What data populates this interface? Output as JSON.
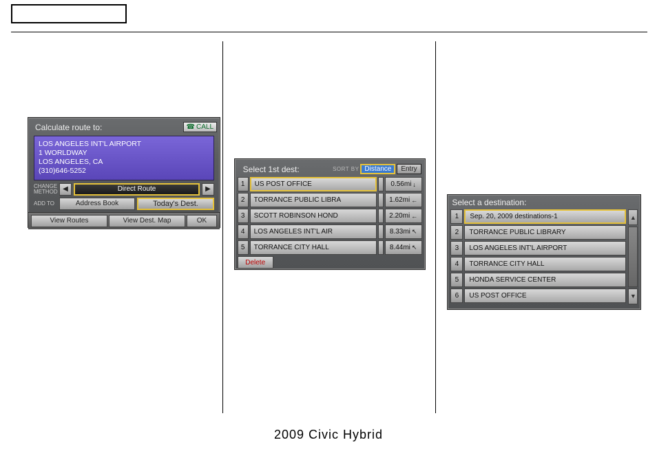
{
  "footer": "2009  Civic  Hybrid",
  "panel1": {
    "title": "Calculate route to:",
    "call": "CALL",
    "address": {
      "line1": "LOS ANGELES INT'L AIRPORT",
      "line2": "1 WORLDWAY",
      "line3": "LOS ANGELES, CA",
      "line4": "(310)646-5252"
    },
    "change_method_label": "CHANGE METHOD",
    "direct_route": "Direct Route",
    "add_to_label": "ADD TO",
    "address_book": "Address Book",
    "todays_dest": "Today's Dest.",
    "view_routes": "View Routes",
    "view_dest_map": "View Dest. Map",
    "ok": "OK"
  },
  "panel2": {
    "title": "Select 1st dest:",
    "sort_label": "SORT BY",
    "sort_distance": "Distance",
    "sort_entry": "Entry",
    "rows": [
      {
        "n": "1",
        "name": "US POST OFFICE",
        "dist": "0.56mi",
        "dir": "↓"
      },
      {
        "n": "2",
        "name": "TORRANCE PUBLIC LIBRA",
        "dist": "1.62mi",
        "dir": "←"
      },
      {
        "n": "3",
        "name": "SCOTT ROBINSON HOND",
        "dist": "2.20mi",
        "dir": "←"
      },
      {
        "n": "4",
        "name": "LOS ANGELES INT'L AIR",
        "dist": "8.33mi",
        "dir": "↖"
      },
      {
        "n": "5",
        "name": "TORRANCE CITY HALL",
        "dist": "8.44mi",
        "dir": "↖"
      }
    ],
    "delete": "Delete"
  },
  "panel3": {
    "title": "Select a destination:",
    "rows": [
      {
        "n": "1",
        "name": "Sep. 20, 2009 destinations-1"
      },
      {
        "n": "2",
        "name": "TORRANCE PUBLIC LIBRARY"
      },
      {
        "n": "3",
        "name": "LOS ANGELES INT'L AIRPORT"
      },
      {
        "n": "4",
        "name": "TORRANCE CITY HALL"
      },
      {
        "n": "5",
        "name": "HONDA SERVICE CENTER"
      },
      {
        "n": "6",
        "name": "US POST OFFICE"
      }
    ],
    "scroll_up": "▲",
    "scroll_down": "▼"
  }
}
